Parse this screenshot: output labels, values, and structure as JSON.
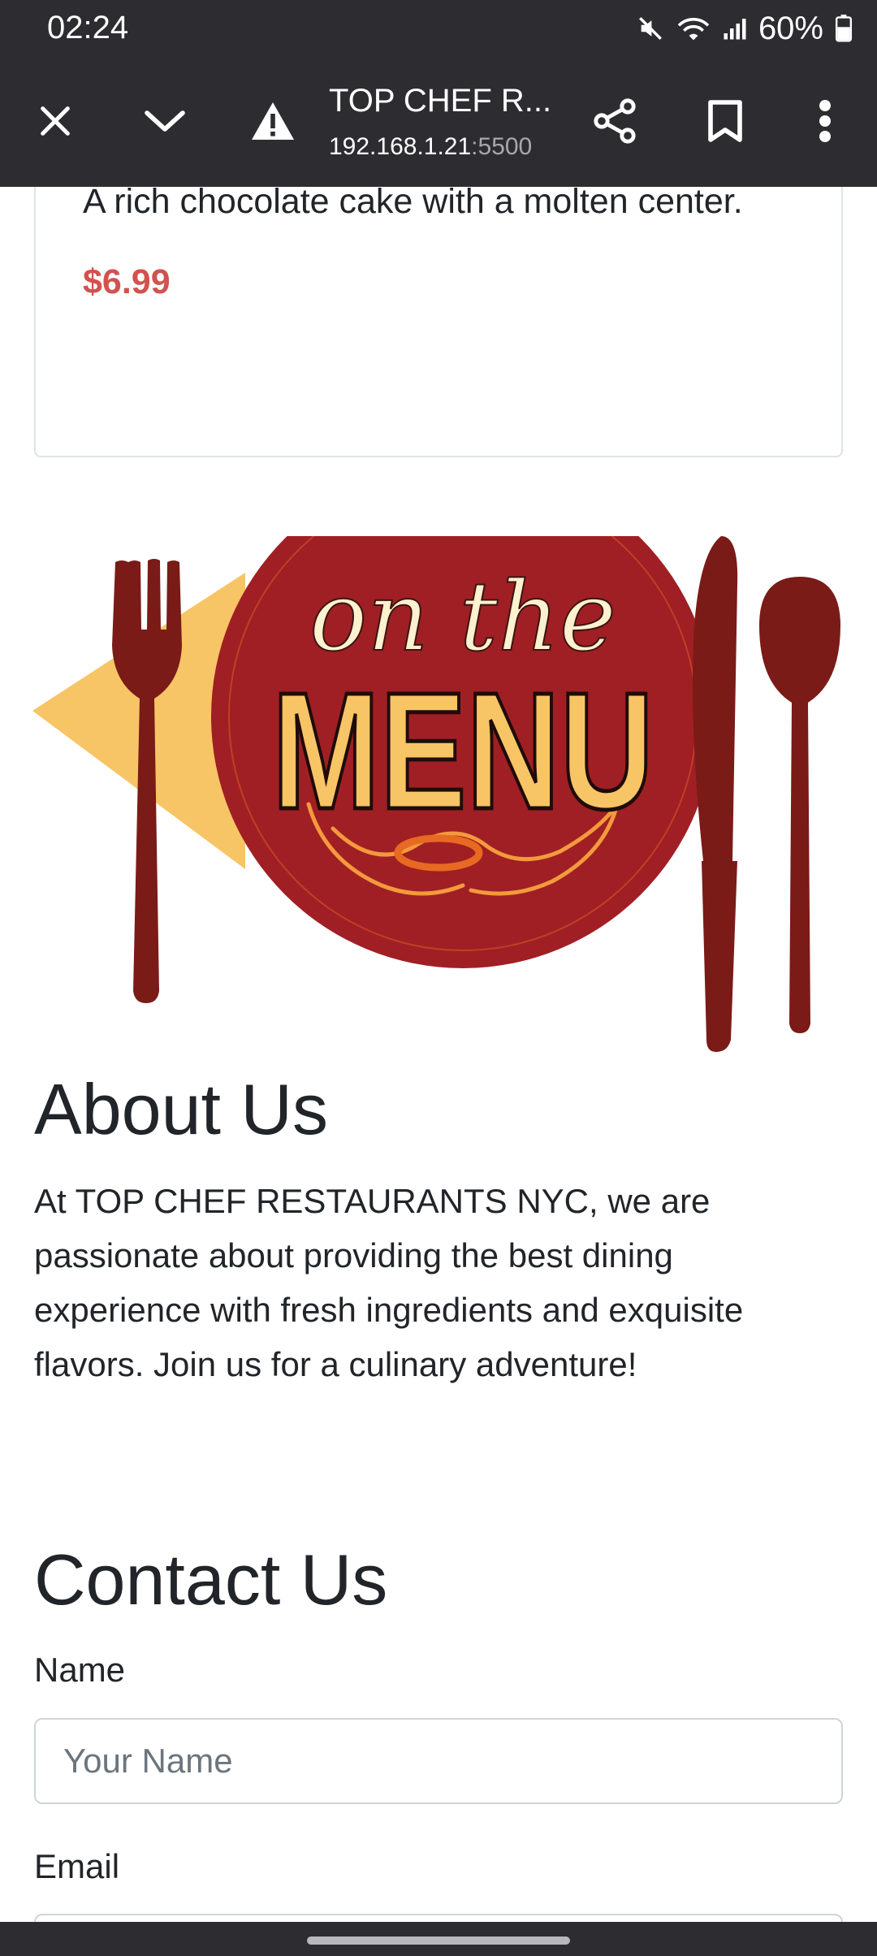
{
  "status_bar": {
    "time": "02:24",
    "battery": "60%",
    "icons": [
      "mute-icon",
      "wifi-icon",
      "signal-icon",
      "battery-icon"
    ]
  },
  "browser": {
    "page_title": "TOP CHEF R...",
    "url_host": "192.168.1.21",
    "url_port": ":5500",
    "icons": [
      "close-icon",
      "chevron-down-icon",
      "warning-icon",
      "share-icon",
      "bookmark-icon",
      "more-vert-icon"
    ]
  },
  "menu_card": {
    "description": "A rich chocolate cake with a molten center.",
    "price": "$6.99"
  },
  "logo": {
    "text_top": "on the",
    "text_main": "MENU"
  },
  "about": {
    "title": "About Us",
    "text": "At TOP CHEF RESTAURANTS NYC, we are passionate about providing the best dining experience with fresh ingredients and exquisite flavors. Join us for a culinary adventure!"
  },
  "contact": {
    "title": "Contact Us",
    "name_label": "Name",
    "name_placeholder": "Your Name",
    "email_label": "Email"
  },
  "colors": {
    "chrome": "#2d2d31",
    "price": "#d0534f",
    "logo_red": "#a01f24",
    "logo_dark_red": "#7a1b17",
    "logo_yellow": "#f7c565"
  }
}
